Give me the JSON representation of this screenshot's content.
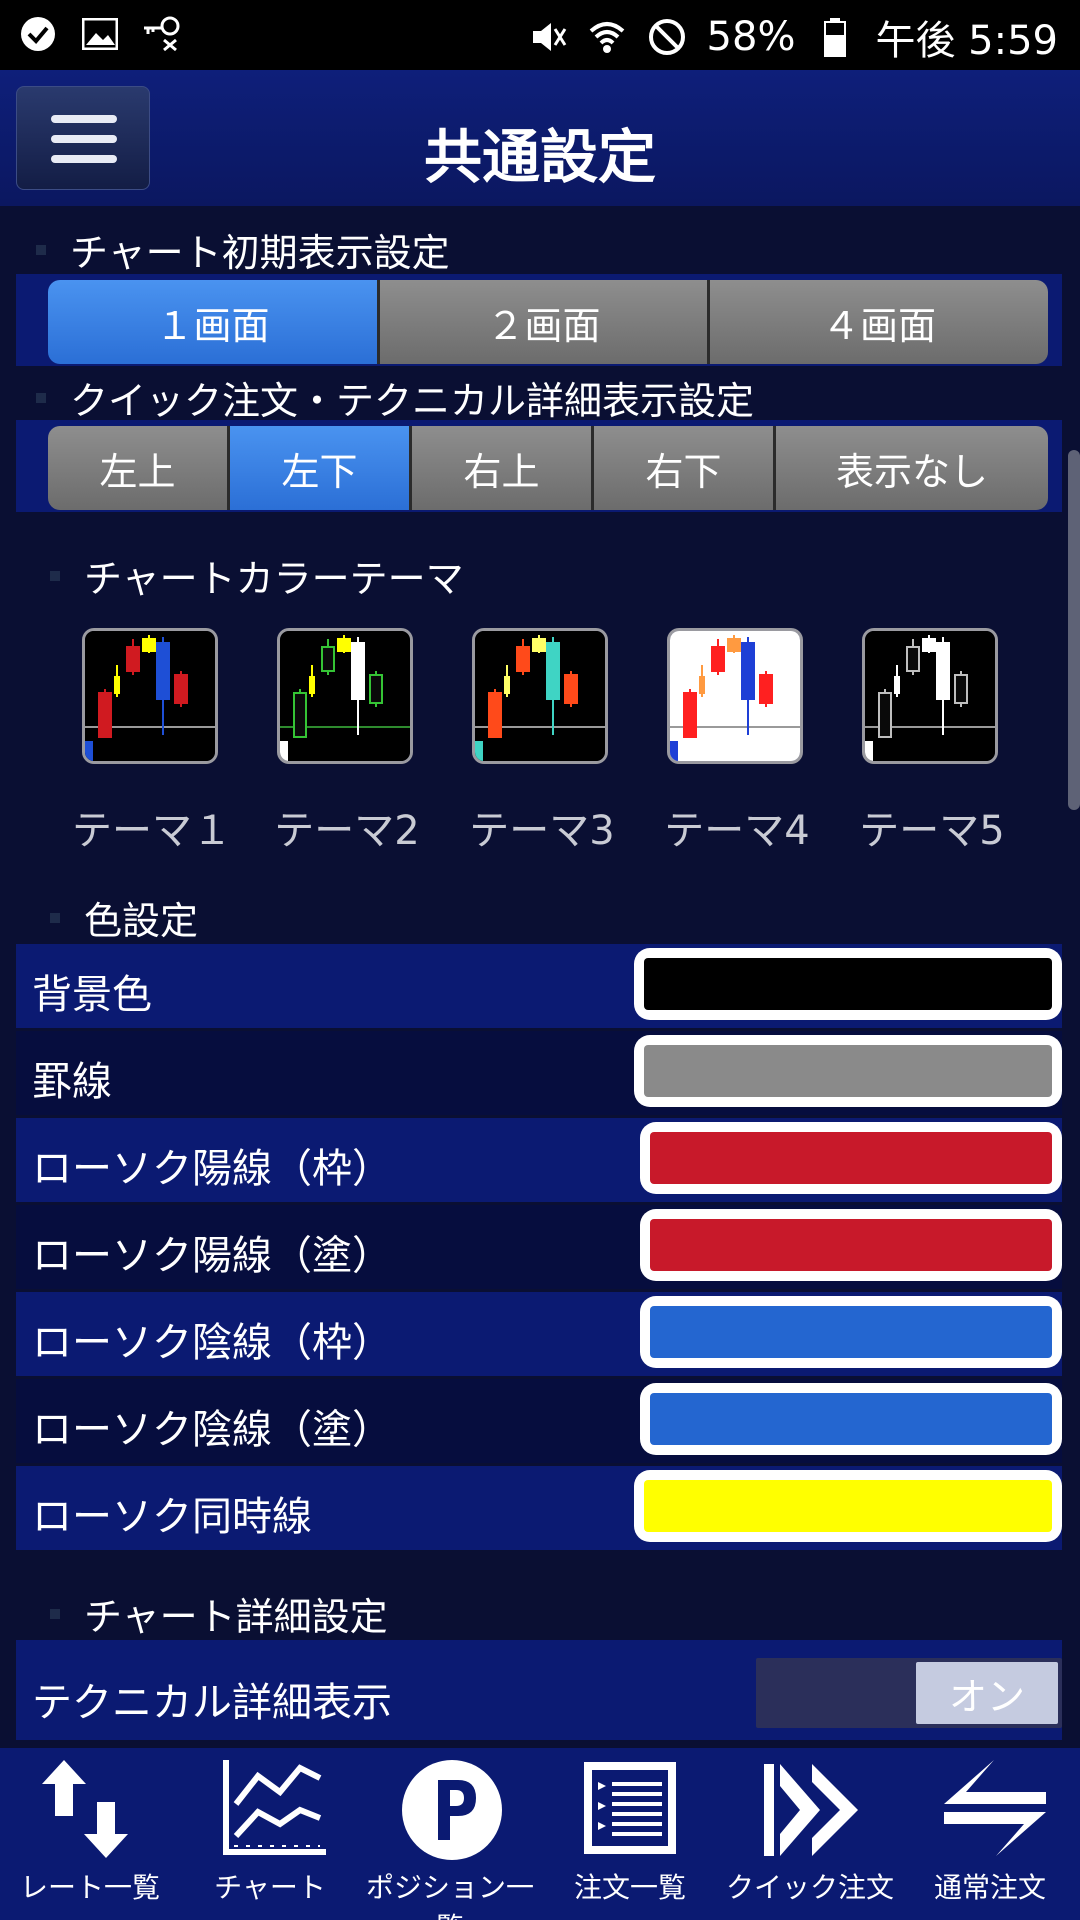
{
  "status_bar": {
    "battery": "58%",
    "time": "午後 5:59",
    "left_icons": [
      "check-circle-icon",
      "image-icon",
      "key-icon"
    ],
    "right_icons": [
      "mute-icon",
      "wifi-icon",
      "block-icon",
      "battery-icon"
    ]
  },
  "header": {
    "title": "共通設定",
    "menu_icon": "hamburger-menu-icon"
  },
  "chart_display": {
    "heading": "チャート初期表示設定",
    "options": [
      "１画面",
      "２画面",
      "４画面"
    ],
    "selected": "１画面"
  },
  "quick_order": {
    "heading": "クイック注文・テクニカル詳細表示設定",
    "options": [
      "左上",
      "左下",
      "右上",
      "右下",
      "表示なし"
    ],
    "selected": "左下"
  },
  "color_theme": {
    "heading": "チャートカラーテーマ",
    "themes": [
      {
        "label": "テーマ１",
        "bg": "#000000",
        "up": "#d01a20",
        "down": "#1e4fd6",
        "same": "#ffff00",
        "grid": "#9a9a9a"
      },
      {
        "label": "テーマ2",
        "bg": "#000000",
        "up": "#0a0a0a",
        "down": "#ffffff",
        "same": "#ffff00",
        "grid": "#2e8b2e",
        "frame": "#35c435"
      },
      {
        "label": "テーマ3",
        "bg": "#000000",
        "up": "#ff4a1a",
        "down": "#3fd4c4",
        "same": "#ffff66",
        "grid": "#9a9a9a"
      },
      {
        "label": "テーマ4",
        "bg": "#ffffff",
        "up": "#ff2020",
        "down": "#1e3fd6",
        "same": "#ff9a40",
        "grid": "#9a9a9a"
      },
      {
        "label": "テーマ5",
        "bg": "#000000",
        "up": "#0a0a0a",
        "down": "#ffffff",
        "same": "#ffffff",
        "grid": "#9a9a9a",
        "frame": "#bfbfbf"
      }
    ]
  },
  "color_settings": {
    "heading": "色設定",
    "rows": [
      {
        "label": "背景色",
        "color": "#000000"
      },
      {
        "label": "罫線",
        "color": "#8a8a8a"
      },
      {
        "label": "ローソク陽線（枠）",
        "color": "#c8192a"
      },
      {
        "label": "ローソク陽線（塗）",
        "color": "#c8192a"
      },
      {
        "label": "ローソク陰線（枠）",
        "color": "#2466d0"
      },
      {
        "label": "ローソク陰線（塗）",
        "color": "#2466d0"
      },
      {
        "label": "ローソク同時線",
        "color": "#ffff00"
      }
    ]
  },
  "chart_detail": {
    "heading": "チャート詳細設定",
    "technical_label": "テクニカル詳細表示",
    "toggle_value": "オン"
  },
  "bottom_nav": [
    {
      "label": "レート一覧",
      "icon": "up-down-arrows-icon"
    },
    {
      "label": "チャート",
      "icon": "line-chart-icon"
    },
    {
      "label": "ポジション一覧",
      "icon": "p-circle-icon"
    },
    {
      "label": "注文一覧",
      "icon": "order-list-icon"
    },
    {
      "label": "クイック注文",
      "icon": "fast-forward-icon"
    },
    {
      "label": "通常注文",
      "icon": "exchange-arrows-icon"
    }
  ]
}
